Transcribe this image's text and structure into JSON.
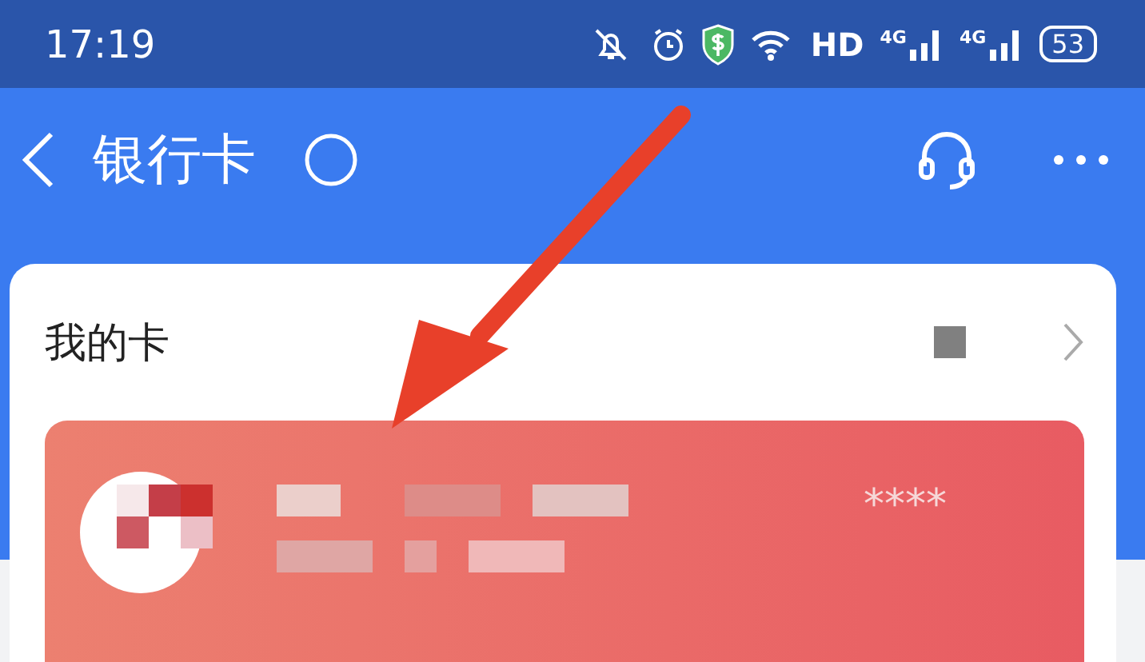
{
  "status_bar": {
    "time": "17:19",
    "hd": "HD",
    "networks": [
      "4G",
      "4G"
    ],
    "battery": "53"
  },
  "header": {
    "title": "银行卡"
  },
  "section": {
    "title": "我的卡"
  },
  "card": {
    "masked_number": "****"
  }
}
